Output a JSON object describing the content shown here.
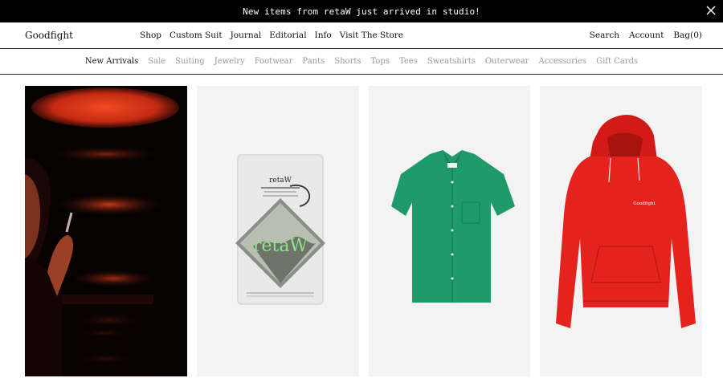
{
  "announcement": {
    "text": "New items from retaW just arrived in studio!"
  },
  "header": {
    "logo": "Goodfight",
    "nav": [
      "Shop",
      "Custom Suit",
      "Journal",
      "Editorial",
      "Info",
      "Visit The Store"
    ],
    "search": "Search",
    "account": "Account",
    "bag": "Bag(0)"
  },
  "subnav": {
    "items": [
      "New Arrivals",
      "Sale",
      "Suiting",
      "Jewelry",
      "Footwear",
      "Pants",
      "Shorts",
      "Tops",
      "Tees",
      "Sweatshirts",
      "Outerwear",
      "Accessories",
      "Gift Cards"
    ],
    "active": "New Arrivals"
  },
  "products": {
    "tag_brand": "retaW",
    "tag_logo": "retaW",
    "hoodie_print": "Goodfight"
  },
  "colors": {
    "shirt": "#1f9a6a",
    "hoodie": "#e4221e",
    "tag_green": "#8fe38a",
    "photo_red": "#d8361a"
  }
}
